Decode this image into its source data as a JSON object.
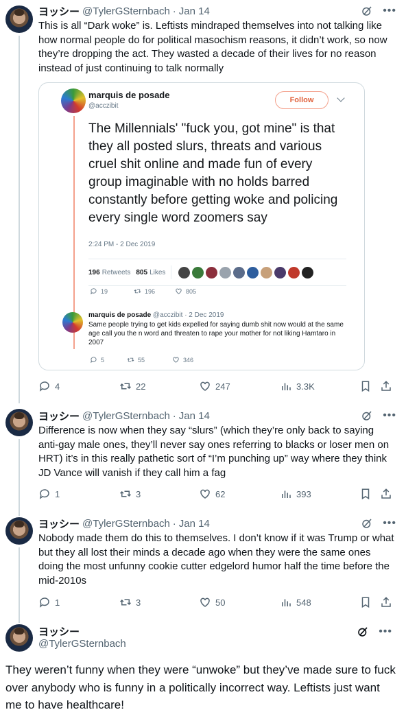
{
  "author": {
    "name": "ヨッシー",
    "handle": "@TylerGSternbach"
  },
  "tweets": [
    {
      "date": "Jan 14",
      "text": "This is all “Dark woke” is. Leftists mindraped themselves into not talking like how normal people do for political masochism reasons, it didn’t work, so now they’re dropping the act. They wasted a decade of their lives for no reason instead of just continuing to talk normally",
      "replies": "4",
      "reposts": "22",
      "likes": "247",
      "views": "3.3K"
    },
    {
      "date": "Jan 14",
      "text": "Difference is now when they say “slurs” (which they’re only back to saying anti-gay male ones, they’ll never say ones referring to blacks or loser men on HRT) it’s in this really pathetic sort of “I’m punching up” way where they think JD Vance will vanish if they call him a fag",
      "replies": "1",
      "reposts": "3",
      "likes": "62",
      "views": "393"
    },
    {
      "date": "Jan 14",
      "text": "Nobody made them do this to themselves. I don’t know if it was Trump or what but they all lost their minds a decade ago when they were the same ones doing the most unfunny cookie cutter edgelord humor half the time before the mid-2010s",
      "replies": "1",
      "reposts": "3",
      "likes": "50",
      "views": "548"
    }
  ],
  "main_tweet": {
    "text": "They weren’t funny when they were “unwoke” but they’ve made sure to fuck over anybody who is funny in a politically incorrect way. Leftists just want me to have healthcare!"
  },
  "embedded": {
    "name": "marquis de posade",
    "handle": "@acczibit",
    "follow_label": "Follow",
    "text": "The Millennials' \"fuck you, got mine\" is that they all posted slurs, threats and various cruel shit online and made fun of every group imaginable with no holds barred constantly before getting woke and policing every single word zoomers say",
    "timestamp": "2:24 PM - 2 Dec 2019",
    "retweets_count": "196",
    "retweets_label": "Retweets",
    "likes_count": "805",
    "likes_label": "Likes",
    "replies": "19",
    "reposts": "196",
    "likes": "805",
    "reply": {
      "name": "marquis de posade",
      "handle_date": "@acczibit · 2 Dec 2019",
      "text": "Same people trying to get kids expelled for saying dumb shit now would at the same age call you the n word and threaten to rape your mother for not liking Hamtaro in 2007",
      "replies": "5",
      "reposts": "55",
      "likes": "346"
    }
  },
  "colors": {
    "text": "#0f1419",
    "muted": "#536471",
    "border": "#cfd9de",
    "embed_accent": "#e0613b"
  }
}
